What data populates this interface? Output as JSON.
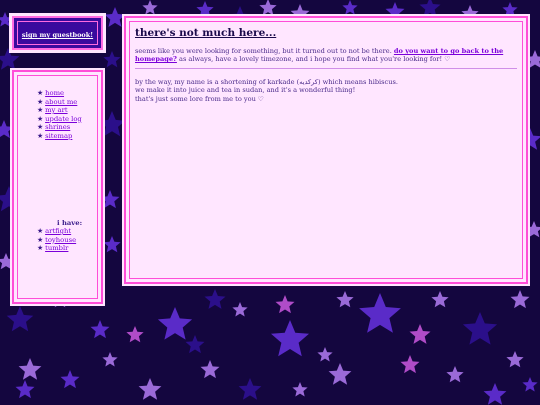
{
  "guestbook": {
    "label": "sign my guestbook!"
  },
  "nav": {
    "items": [
      {
        "label": "home"
      },
      {
        "label": "about me"
      },
      {
        "label": "my art"
      },
      {
        "label": "update log"
      },
      {
        "label": "shrines"
      },
      {
        "label": "sitemap"
      }
    ],
    "section_title": "i have:",
    "extra_items": [
      {
        "label": "artfight"
      },
      {
        "label": "toyhouse"
      },
      {
        "label": "tumblr"
      }
    ],
    "bullet": "★"
  },
  "main": {
    "title": "there's not much here...",
    "para1_before": "seems like you were looking for something, but it turned out to not be there. ",
    "para1_link": "do you want to go back to the homepage?",
    "para1_after": " as always, have a lovely timezone, and i hope you find what you're looking for! ♡",
    "para2_lines": [
      "by the way, my name is a shortening of karkade (كركديه) which means hibiscus.",
      "we make it into juice and tea in sudan, and it's a wonderful thing!",
      "that's just some lore from me to you ♡"
    ]
  },
  "colors": {
    "background": "#14063f",
    "panel": "#ffe6ff",
    "border": "#ff4dd8",
    "link": "#7a00d9",
    "star_colors": [
      "#2b0f8a",
      "#5a2bc8",
      "#9a6ad8",
      "#b04cc8"
    ]
  }
}
